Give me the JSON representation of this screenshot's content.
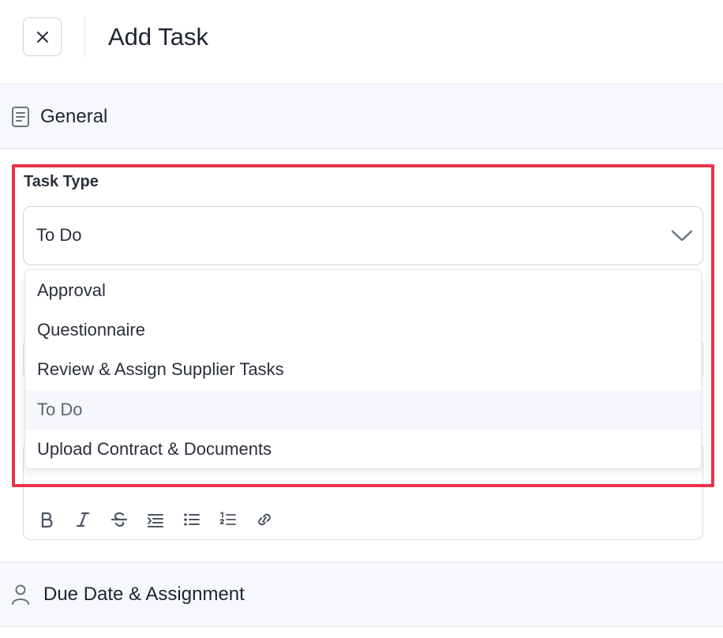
{
  "header": {
    "title": "Add Task",
    "close_icon": "close-icon"
  },
  "sections": {
    "general": {
      "label": "General",
      "icon": "document-icon"
    },
    "due": {
      "label": "Due Date & Assignment",
      "icon": "person-icon"
    }
  },
  "task_type": {
    "label": "Task Type",
    "value": "To Do",
    "options": [
      "Approval",
      "Questionnaire",
      "Review & Assign Supplier Tasks",
      "To Do",
      "Upload Contract & Documents"
    ],
    "selected_index": 3
  },
  "toolbar": {
    "buttons": [
      "bold-icon",
      "italic-icon",
      "strikethrough-icon",
      "indent-list-icon",
      "bullet-list-icon",
      "numbered-list-icon",
      "link-icon"
    ]
  },
  "colors": {
    "highlight": "#e8334a",
    "section_bg": "#f6f8fc",
    "selected_option_bg": "#f5f7fa"
  }
}
